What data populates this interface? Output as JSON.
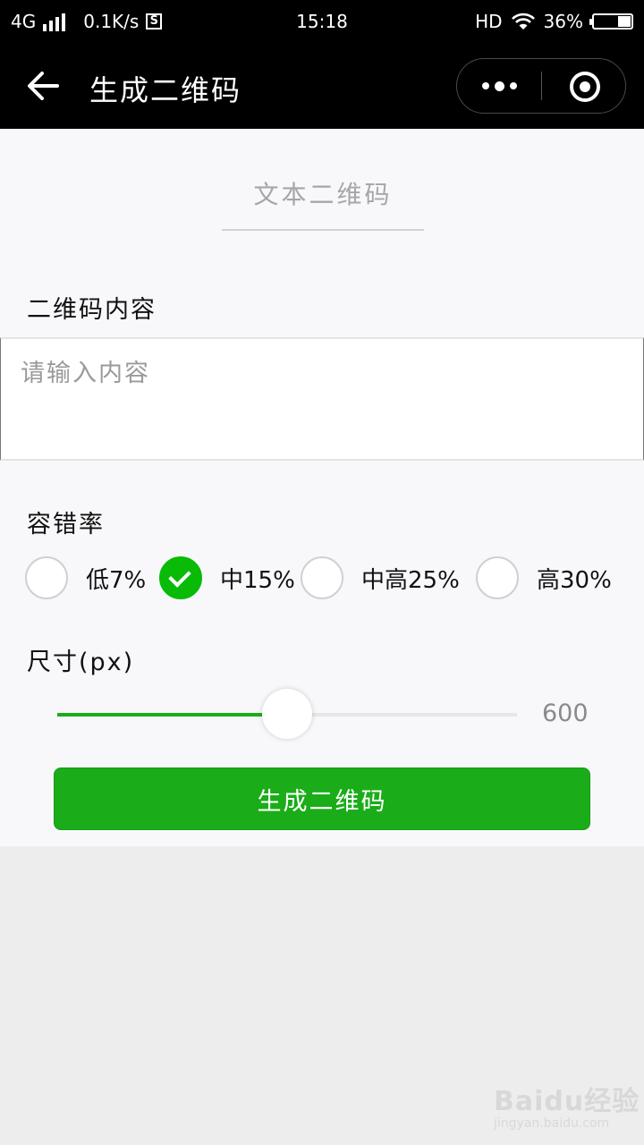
{
  "status_bar": {
    "network": "4G",
    "speed": "0.1K/s",
    "app_badge": "S",
    "time": "15:18",
    "hd": "HD",
    "battery_text": "36%",
    "battery_level": 0.36
  },
  "nav": {
    "title": "生成二维码",
    "back_icon": "arrow-left-icon",
    "more_icon": "more-dots-icon",
    "close_icon": "target-close-icon"
  },
  "tab": {
    "label": "文本二维码"
  },
  "content": {
    "label": "二维码内容",
    "placeholder": "请输入内容",
    "value": ""
  },
  "error_rate": {
    "label": "容错率",
    "options": [
      {
        "label": "低7%",
        "checked": false
      },
      {
        "label": "中15%",
        "checked": true
      },
      {
        "label": "中高25%",
        "checked": false
      },
      {
        "label": "高30%",
        "checked": false
      }
    ]
  },
  "size": {
    "label": "尺寸(px)",
    "value": "600",
    "fraction": 0.5
  },
  "generate_button": {
    "label": "生成二维码"
  },
  "watermark": {
    "logo": "Baidu经验",
    "url": "jingyan.baidu.com"
  },
  "colors": {
    "accent": "#1aad19",
    "checked": "#09bb07"
  }
}
